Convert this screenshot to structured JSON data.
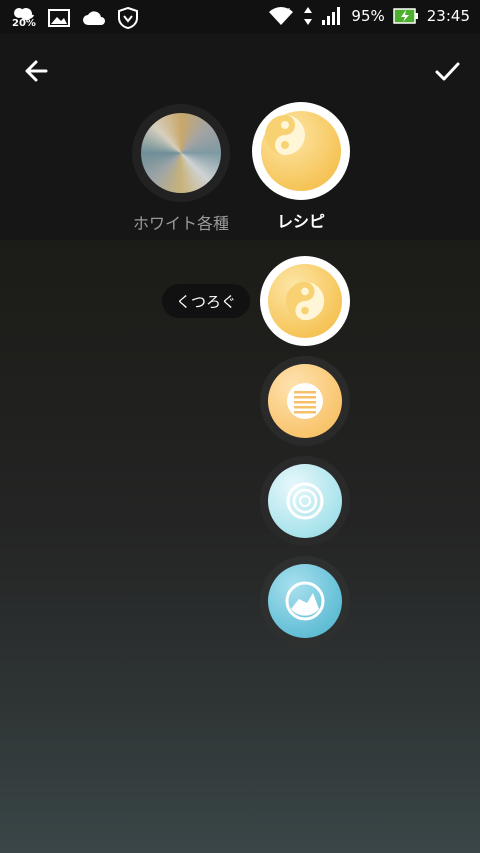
{
  "status_bar": {
    "weather_percent": "20%",
    "battery_percent": "95%",
    "time": "23:45",
    "battery_color": "#4caf2d"
  },
  "toolbar": {
    "back_icon": "arrow-left-icon",
    "confirm_icon": "check-icon"
  },
  "modes": [
    {
      "label": "ホワイト各種",
      "selected": false
    },
    {
      "label": "レシピ",
      "selected": true
    }
  ],
  "presets": [
    {
      "icon": "yin-yang-icon",
      "selected": true
    },
    {
      "icon": "lines-icon",
      "selected": false
    },
    {
      "icon": "concentric-circles-icon",
      "selected": false
    },
    {
      "icon": "half-moon-icon",
      "selected": false
    }
  ],
  "tooltip": {
    "label": "くつろぐ"
  }
}
